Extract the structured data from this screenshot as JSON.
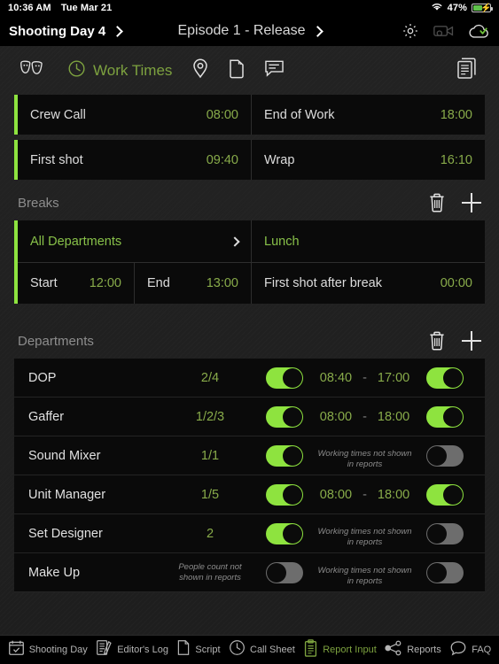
{
  "status_bar": {
    "time": "10:36 AM",
    "date": "Tue Mar 21",
    "battery_percent": "47%",
    "wifi_icon": "wifi-icon",
    "battery_icon": "battery-charging-icon"
  },
  "header": {
    "shooting_day": "Shooting Day 4",
    "episode": "Episode 1 - Release",
    "settings_icon": "gear-icon",
    "video_icon": "video-camera-icon",
    "cloud_icon": "cloud-synced-icon"
  },
  "toolbar": {
    "items": [
      {
        "name": "masks-icon",
        "label": ""
      },
      {
        "name": "clock-icon",
        "label": "Work Times"
      },
      {
        "name": "location-pin-icon",
        "label": ""
      },
      {
        "name": "sd-card-icon",
        "label": ""
      },
      {
        "name": "comment-icon",
        "label": ""
      }
    ],
    "documents_icon": "documents-stack-icon"
  },
  "work_times": {
    "rows": [
      {
        "left_label": "Crew Call",
        "left_value": "08:00",
        "right_label": "End of Work",
        "right_value": "18:00"
      },
      {
        "left_label": "First shot",
        "left_value": "09:40",
        "right_label": "Wrap",
        "right_value": "16:10"
      }
    ]
  },
  "breaks": {
    "title": "Breaks",
    "delete_icon": "trash-icon",
    "add_icon": "plus-icon",
    "entry": {
      "departments": "All Departments",
      "name": "Lunch",
      "start_label": "Start",
      "start_value": "12:00",
      "end_label": "End",
      "end_value": "13:00",
      "first_shot_label": "First shot after break",
      "first_shot_value": "00:00"
    }
  },
  "departments": {
    "title": "Departments",
    "delete_icon": "trash-icon",
    "add_icon": "plus-icon",
    "no_people_text": "People count not shown in reports",
    "no_times_text": "Working times not shown in reports",
    "rows": [
      {
        "name": "DOP",
        "count": "2/4",
        "count_muted": false,
        "people_toggle": "on",
        "start": "08:40",
        "end": "17:00",
        "times_muted": false,
        "times_toggle": "on"
      },
      {
        "name": "Gaffer",
        "count": "1/2/3",
        "count_muted": false,
        "people_toggle": "on",
        "start": "08:00",
        "end": "18:00",
        "times_muted": false,
        "times_toggle": "on"
      },
      {
        "name": "Sound Mixer",
        "count": "1/1",
        "count_muted": false,
        "people_toggle": "on",
        "start": "",
        "end": "",
        "times_muted": true,
        "times_toggle": "off"
      },
      {
        "name": "Unit Manager",
        "count": "1/5",
        "count_muted": false,
        "people_toggle": "on",
        "start": "08:00",
        "end": "18:00",
        "times_muted": false,
        "times_toggle": "on"
      },
      {
        "name": "Set Designer",
        "count": "2",
        "count_muted": false,
        "people_toggle": "on",
        "start": "",
        "end": "",
        "times_muted": true,
        "times_toggle": "off"
      },
      {
        "name": "Make Up",
        "count": "",
        "count_muted": true,
        "people_toggle": "off",
        "start": "",
        "end": "",
        "times_muted": true,
        "times_toggle": "off"
      }
    ]
  },
  "tabbar": {
    "tabs": [
      {
        "label": "Shooting Day",
        "icon": "calendar-check-icon",
        "active": false
      },
      {
        "label": "Editor's Log",
        "icon": "notebook-pen-icon",
        "active": false
      },
      {
        "label": "Script",
        "icon": "script-page-icon",
        "active": false
      },
      {
        "label": "Call Sheet",
        "icon": "clock-icon",
        "active": false
      },
      {
        "label": "Report Input",
        "icon": "clipboard-icon",
        "active": true
      },
      {
        "label": "Reports",
        "icon": "share-icon",
        "active": false
      },
      {
        "label": "FAQ",
        "icon": "question-bubble-icon",
        "active": false
      }
    ]
  },
  "colors": {
    "accent_green": "#8ee33f",
    "muted_green": "#88ab4a",
    "toolbar_green": "#7da23f",
    "background": "#1e1e1e"
  }
}
